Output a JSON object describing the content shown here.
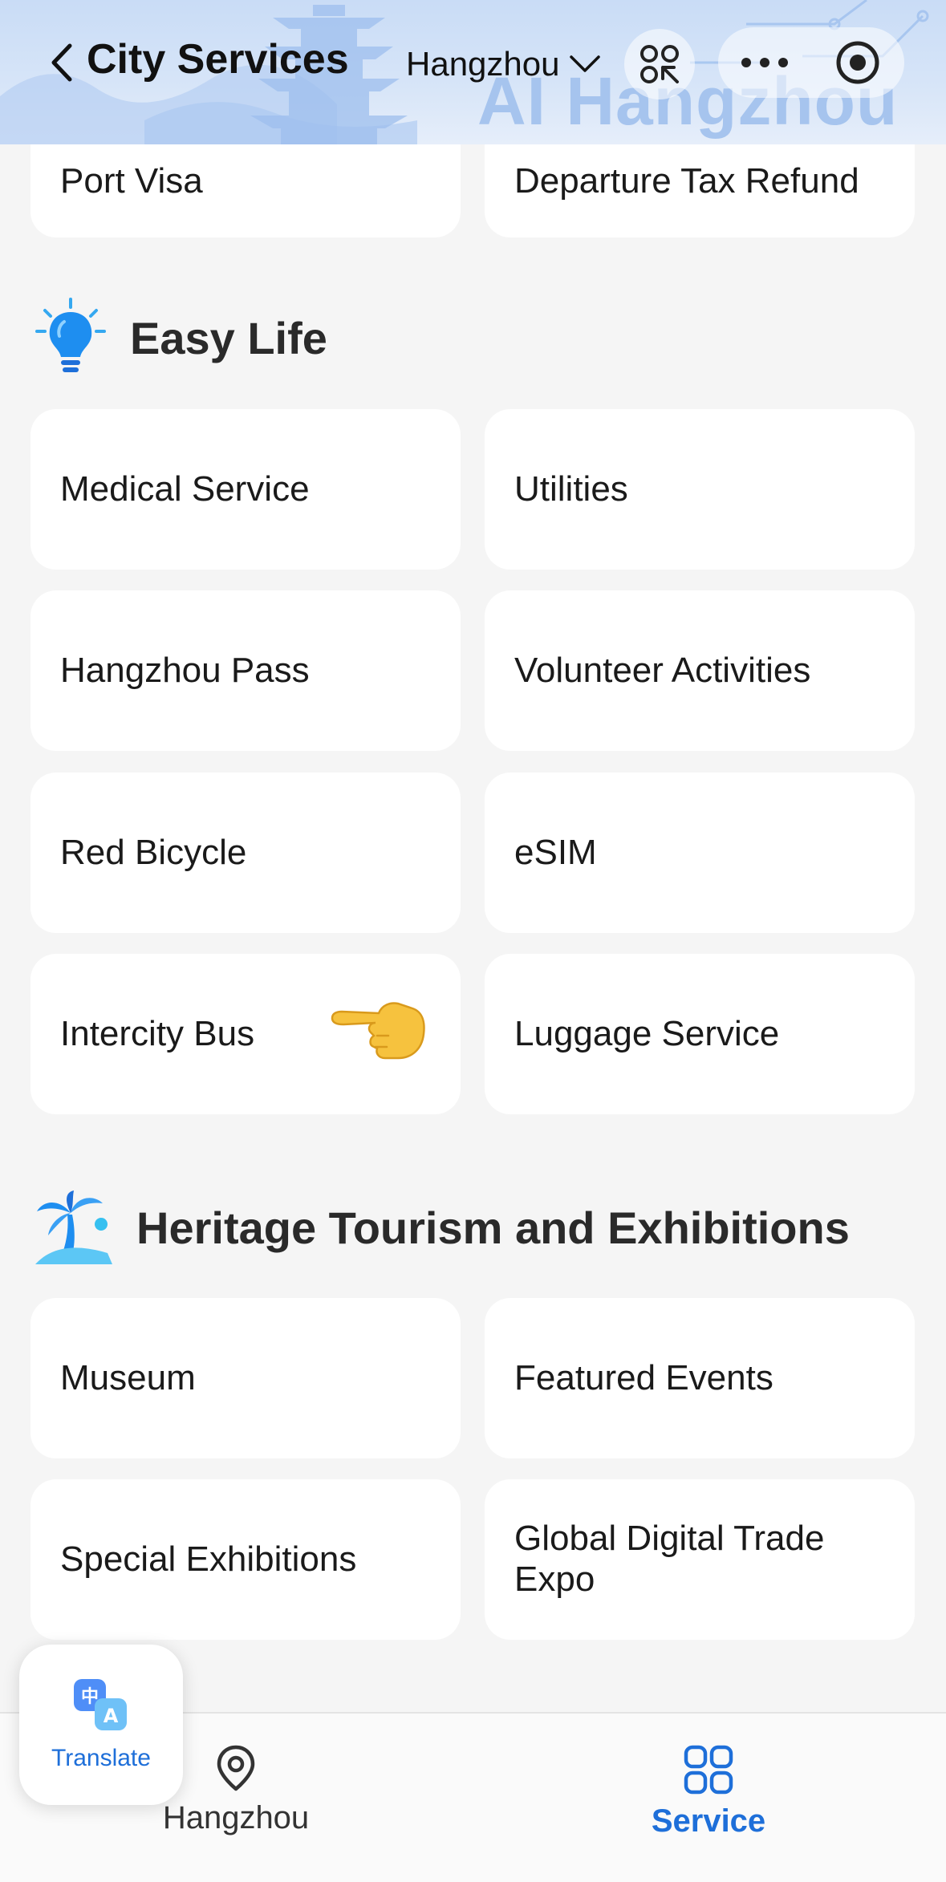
{
  "header": {
    "title": "City Services",
    "city": "Hangzhou",
    "watermark": "AI Hangzhou"
  },
  "top_partial_row": [
    "Port Visa",
    "Departure Tax Refund"
  ],
  "sections": [
    {
      "title": "Easy Life",
      "icon": "lightbulb-icon",
      "items": [
        "Medical Service",
        "Utilities",
        "Hangzhou Pass",
        "Volunteer Activities",
        "Red Bicycle",
        "eSIM",
        "Intercity Bus",
        "Luggage Service"
      ]
    },
    {
      "title": "Heritage Tourism and Exhibitions",
      "icon": "palm-tree-icon",
      "items": [
        "Museum",
        "Featured Events",
        "Special Exhibitions",
        "Global Digital Trade Expo"
      ]
    }
  ],
  "translate": {
    "label": "Translate"
  },
  "tabs": [
    {
      "label": "Hangzhou",
      "icon": "location-pin-icon",
      "active": false
    },
    {
      "label": "Service",
      "icon": "grid-icon",
      "active": true
    }
  ],
  "colors": {
    "accent": "#1e6fd9",
    "header_bg": "#c9dcf6",
    "page_bg": "#f5f5f5",
    "card_bg": "#ffffff"
  }
}
